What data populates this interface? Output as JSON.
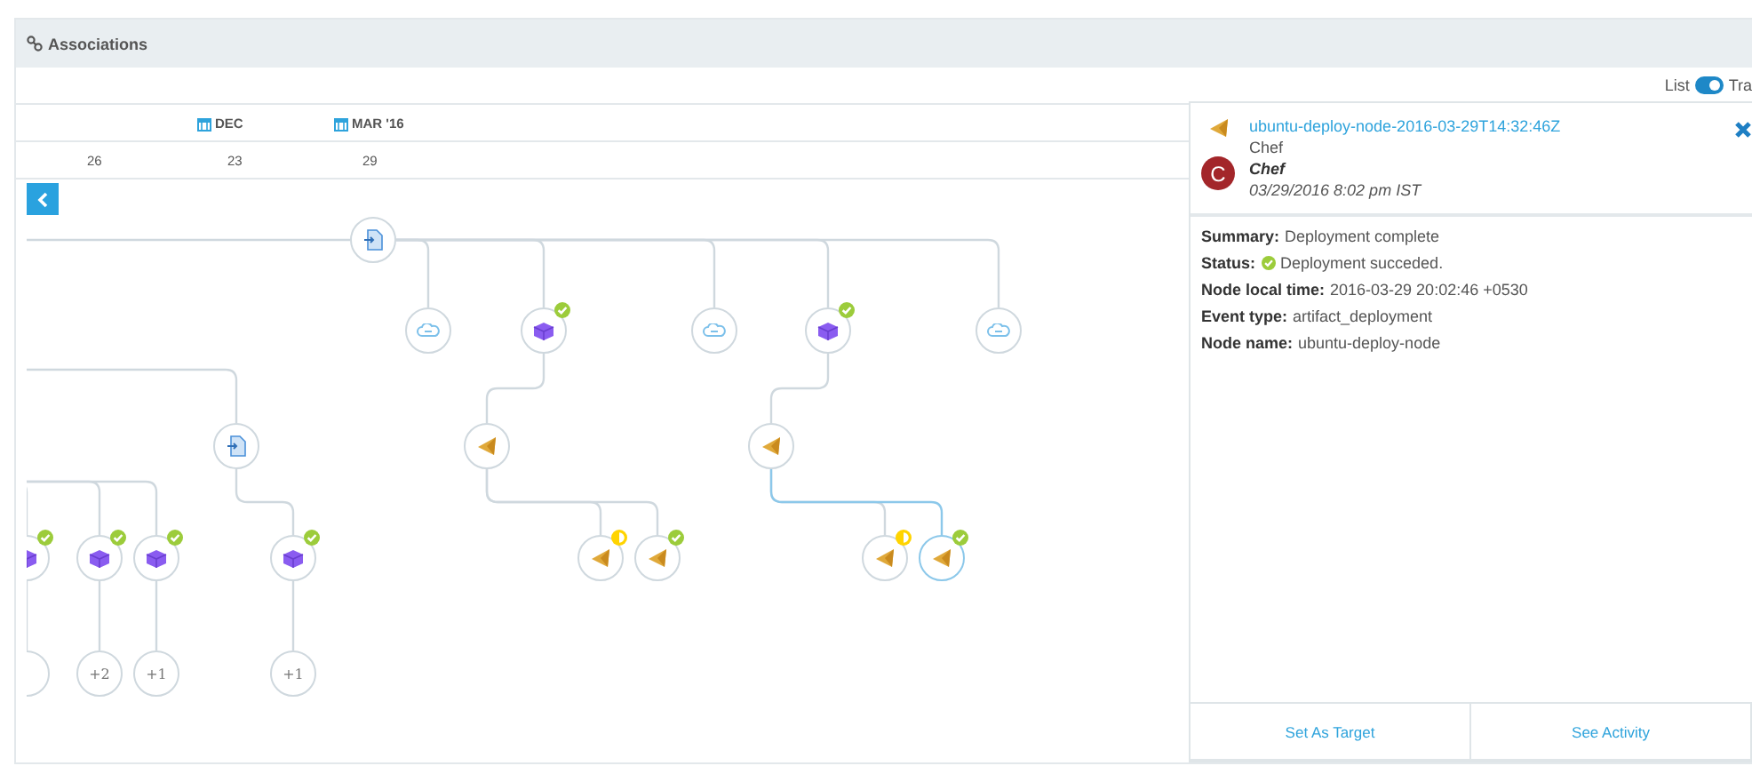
{
  "panel": {
    "title": "Associations"
  },
  "view_toggle": {
    "label": "List",
    "on": true,
    "next_label": "Tra"
  },
  "timeline": {
    "months": [
      "DEC",
      "MAR '16"
    ],
    "days": [
      "26",
      "23",
      "29"
    ]
  },
  "graph": {
    "nodes": [
      {
        "kind": "artifact",
        "selected": false,
        "children": [
          {
            "kind": "cloud",
            "selected": false
          },
          {
            "kind": "package",
            "selected": false,
            "badge": {
              "kind": "check"
            },
            "children": [
              {
                "kind": "chef",
                "selected": false,
                "children": [
                  {
                    "kind": "chef",
                    "selected": false,
                    "badge": {
                      "kind": "half"
                    }
                  },
                  {
                    "kind": "chef",
                    "selected": false,
                    "badge": {
                      "kind": "check"
                    }
                  }
                ]
              }
            ]
          },
          {
            "kind": "cloud",
            "selected": false
          },
          {
            "kind": "package",
            "selected": false,
            "badge": {
              "kind": "check"
            },
            "children": [
              {
                "kind": "chef",
                "selected": false,
                "children": [
                  {
                    "kind": "chef",
                    "selected": false,
                    "badge": {
                      "kind": "half"
                    }
                  },
                  {
                    "kind": "chef",
                    "selected": true,
                    "badge": {
                      "kind": "check"
                    }
                  }
                ]
              }
            ]
          },
          {
            "kind": "cloud",
            "selected": false
          }
        ]
      },
      {
        "kind": "package",
        "selected": false,
        "badge": {
          "kind": "check"
        },
        "children": [
          {
            "kind": "count",
            "selected": false
          }
        ]
      },
      {
        "kind": "package",
        "selected": false,
        "badge": {
          "kind": "check"
        },
        "children": [
          {
            "kind": "count",
            "selected": false,
            "label": "+2"
          }
        ]
      },
      {
        "kind": "package",
        "selected": false,
        "badge": {
          "kind": "check"
        },
        "children": [
          {
            "kind": "count",
            "selected": false,
            "label": "+1"
          }
        ]
      },
      {
        "kind": "artifact",
        "selected": false,
        "children": [
          {
            "kind": "package",
            "selected": false,
            "badge": {
              "kind": "check"
            },
            "children": [
              {
                "kind": "count",
                "selected": false,
                "label": "+1"
              }
            ]
          }
        ]
      }
    ]
  },
  "detail": {
    "title": "ubuntu-deploy-node-2016-03-29T14:32:46Z",
    "source": "Chef",
    "avatar_letter": "C",
    "author": "Chef",
    "time": "03/29/2016 8:02 pm IST",
    "fields": [
      {
        "label": "Summary:",
        "value": "Deployment complete"
      },
      {
        "label": "Status:",
        "value": "Deployment succeded.",
        "kind": "status"
      },
      {
        "label": "Node local time:",
        "value": "2016-03-29 20:02:46 +0530"
      },
      {
        "label": "Event type:",
        "value": "artifact_deployment"
      },
      {
        "label": "Node name:",
        "value": "ubuntu-deploy-node"
      }
    ],
    "buttons": [
      "Set As Target",
      "See Activity"
    ]
  }
}
